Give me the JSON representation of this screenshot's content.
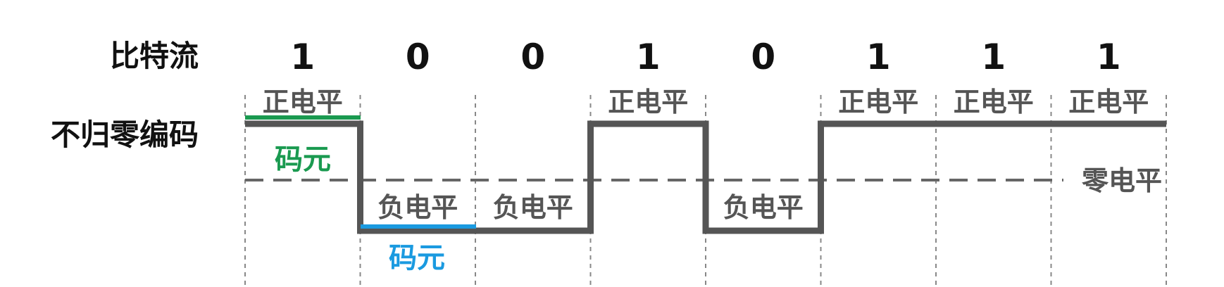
{
  "labels": {
    "bitstream": "比特流",
    "encoding": "不归零编码",
    "zero_level": "零电平"
  },
  "bits": [
    "1",
    "0",
    "0",
    "1",
    "0",
    "1",
    "1",
    "1"
  ],
  "level_labels": [
    "正电平",
    "负电平",
    "负电平",
    "正电平",
    "负电平",
    "正电平",
    "正电平",
    "正电平"
  ],
  "code_unit": {
    "text": "码元",
    "colors": [
      "#1a9a50",
      "#1a9ae0"
    ]
  },
  "colors": {
    "signal": "#555555",
    "divider": "#888888",
    "zero_line": "#666666",
    "highlight_positive": "#1a9a50",
    "highlight_negative": "#1a9ae0"
  }
}
